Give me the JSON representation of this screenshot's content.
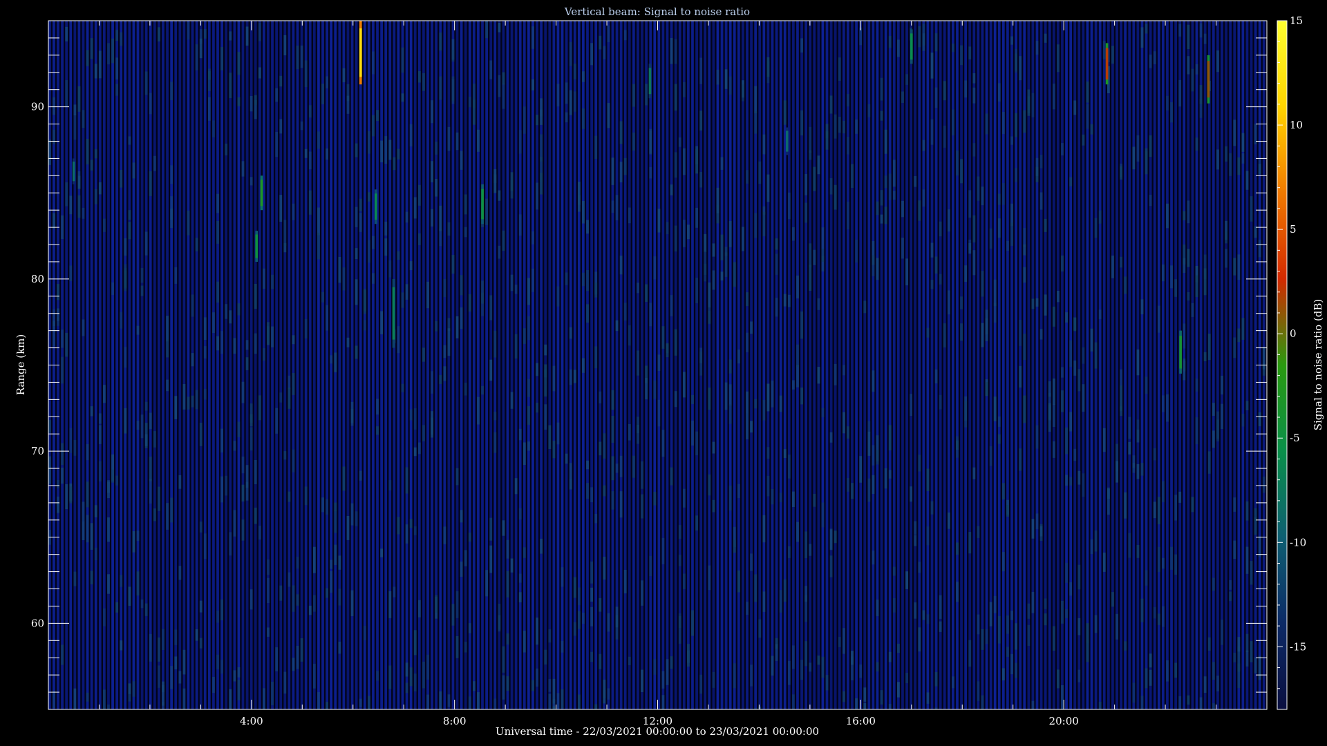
{
  "chart_data": {
    "type": "heatmap",
    "title": "Vertical beam: Signal to noise ratio",
    "xlabel": "Universal time - 22/03/2021 00:00:00 to 23/03/2021 00:00:00",
    "ylabel": "Range (km)",
    "colorbar_label": "Signal to noise ratio (dB)",
    "x_unit": "hours UT",
    "xlim": [
      0,
      24
    ],
    "ylim": [
      55,
      95
    ],
    "x_ticks": [
      {
        "value": 4,
        "label": "4:00"
      },
      {
        "value": 8,
        "label": "8:00"
      },
      {
        "value": 12,
        "label": "12:00"
      },
      {
        "value": 16,
        "label": "16:00"
      },
      {
        "value": 20,
        "label": "20:00"
      }
    ],
    "y_ticks": [
      {
        "value": 60,
        "label": "60"
      },
      {
        "value": 70,
        "label": "70"
      },
      {
        "value": 80,
        "label": "80"
      },
      {
        "value": 90,
        "label": "90"
      }
    ],
    "colorbar_range": [
      -18,
      15
    ],
    "colorbar_ticks": [
      {
        "value": 15,
        "label": "15"
      },
      {
        "value": 10,
        "label": "10"
      },
      {
        "value": 5,
        "label": "5"
      },
      {
        "value": 0,
        "label": "0"
      },
      {
        "value": -5,
        "label": "-5"
      },
      {
        "value": -10,
        "label": "-10"
      },
      {
        "value": -15,
        "label": "-15"
      }
    ],
    "colormap": [
      "#0a0f40",
      "#0c2a66",
      "#0e5f72",
      "#0a8f4a",
      "#2a9a10",
      "#d42a00",
      "#f07a00",
      "#ffd400",
      "#ffff30"
    ],
    "background_level_db": -16,
    "echoes": [
      {
        "time": 0.5,
        "range_bottom": 85.5,
        "range_top": 87.0,
        "snr": -9
      },
      {
        "time": 4.1,
        "range_bottom": 81.0,
        "range_top": 82.8,
        "snr": -5
      },
      {
        "time": 4.2,
        "range_bottom": 84.0,
        "range_top": 86.0,
        "snr": -3
      },
      {
        "time": 6.15,
        "range_bottom": 91.3,
        "range_top": 95.0,
        "snr": 12
      },
      {
        "time": 6.45,
        "range_bottom": 83.2,
        "range_top": 85.2,
        "snr": -6
      },
      {
        "time": 6.8,
        "range_bottom": 76.0,
        "range_top": 80.0,
        "snr": -7
      },
      {
        "time": 8.55,
        "range_bottom": 83.2,
        "range_top": 85.5,
        "snr": -5
      },
      {
        "time": 11.85,
        "range_bottom": 90.5,
        "range_top": 92.5,
        "snr": -8
      },
      {
        "time": 14.55,
        "range_bottom": 87.2,
        "range_top": 88.8,
        "snr": -9
      },
      {
        "time": 17.0,
        "range_bottom": 92.5,
        "range_top": 94.5,
        "snr": -6
      },
      {
        "time": 20.85,
        "range_bottom": 91.3,
        "range_top": 93.7,
        "snr": 2
      },
      {
        "time": 22.3,
        "range_bottom": 74.5,
        "range_top": 77.0,
        "snr": -4
      },
      {
        "time": 22.85,
        "range_bottom": 90.2,
        "range_top": 93.0,
        "snr": 1
      }
    ]
  }
}
